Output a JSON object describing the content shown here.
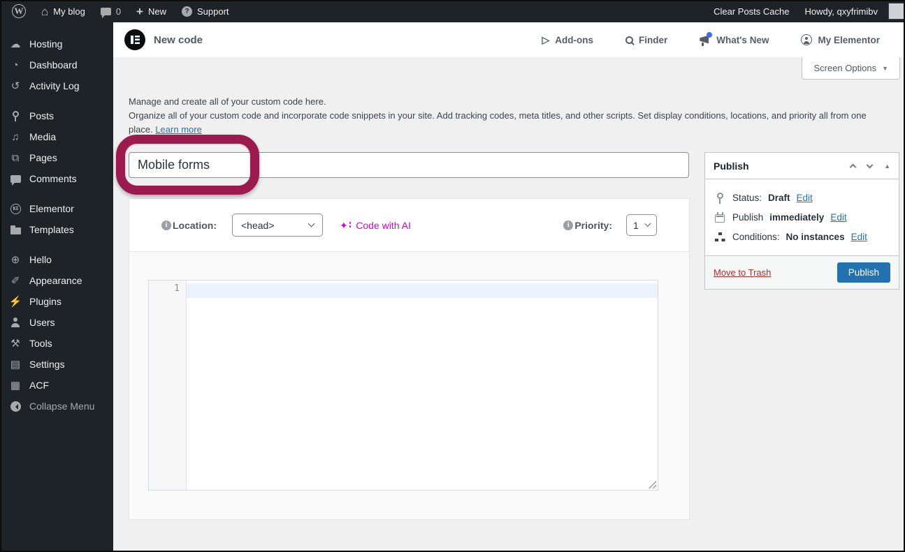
{
  "admin_bar": {
    "site_name": "My blog",
    "comment_count": "0",
    "new_label": "New",
    "support_label": "Support",
    "clear_cache_label": "Clear Posts Cache",
    "howdy_label": "Howdy, qxyfrimibv"
  },
  "sidebar": {
    "items": [
      {
        "label": "Hosting",
        "icon": "cloud-icon"
      },
      {
        "label": "Dashboard",
        "icon": "gauge-icon"
      },
      {
        "label": "Activity Log",
        "icon": "clock-icon"
      },
      {
        "label": "Posts",
        "icon": "pin-icon"
      },
      {
        "label": "Media",
        "icon": "media-icon"
      },
      {
        "label": "Pages",
        "icon": "pages-icon"
      },
      {
        "label": "Comments",
        "icon": "comment-bubble-icon"
      },
      {
        "label": "Elementor",
        "icon": "elementor-icon"
      },
      {
        "label": "Templates",
        "icon": "folder-icon"
      },
      {
        "label": "Hello",
        "icon": "plus-circle-icon"
      },
      {
        "label": "Appearance",
        "icon": "brush-icon"
      },
      {
        "label": "Plugins",
        "icon": "plugin-icon"
      },
      {
        "label": "Users",
        "icon": "user-icon"
      },
      {
        "label": "Tools",
        "icon": "tools-icon"
      },
      {
        "label": "Settings",
        "icon": "settings-icon"
      },
      {
        "label": "ACF",
        "icon": "table-icon"
      },
      {
        "label": "Collapse Menu",
        "icon": "collapse-icon"
      }
    ]
  },
  "elementor_header": {
    "title": "New code",
    "nav": [
      {
        "label": "Add-ons",
        "icon": "addons-icon"
      },
      {
        "label": "Finder",
        "icon": "search-icon"
      },
      {
        "label": "What's New",
        "icon": "megaphone-icon",
        "badge": "blue-dot"
      },
      {
        "label": "My Elementor",
        "icon": "account-icon"
      }
    ]
  },
  "screen_options": {
    "label": "Screen Options"
  },
  "intro": {
    "line1": "Manage and create all of your custom code here.",
    "line2": "Organize all of your custom code and incorporate code snippets in your site. Add tracking codes, meta titles, and other scripts. Set display conditions, locations, and priority all from one place.",
    "learn_more": "Learn more"
  },
  "title_field": {
    "value": "Mobile forms"
  },
  "options_bar": {
    "location_label": "Location:",
    "location_value": "<head>",
    "code_with_ai_label": "Code with AI",
    "priority_label": "Priority:",
    "priority_value": "1"
  },
  "editor": {
    "line_number": "1"
  },
  "publish_box": {
    "title": "Publish",
    "status_label": "Status:",
    "status_value": "Draft",
    "status_edit": "Edit",
    "schedule_label": "Publish",
    "schedule_value": "immediately",
    "schedule_edit": "Edit",
    "conditions_label": "Conditions:",
    "conditions_value": "No instances",
    "conditions_edit": "Edit",
    "move_to_trash_label": "Move to Trash",
    "publish_button_label": "Publish"
  },
  "icons": {
    "wp": "W",
    "home": "⌂",
    "plus": "+",
    "question": "?",
    "cloud": "☁",
    "gauge": "◔",
    "clock": "↺",
    "media": "♫",
    "pages": "⧉",
    "plus_circle": "⊕",
    "brush": "✐",
    "plugin": "⚡",
    "tools": "⚒",
    "settings": "▤",
    "table": "▦",
    "addons": "▷",
    "sparkle": "✦",
    "info": "i",
    "triangle_down": "▼",
    "triangle_up": "▲"
  },
  "colors": {
    "admin_dark": "#1d2327",
    "accent_blue": "#2271b1",
    "ai_pink": "#d004d4",
    "annotation_maroon": "#9b1b4e",
    "trash_red": "#b32d2e",
    "active_line_blue": "#e9f2fd"
  }
}
